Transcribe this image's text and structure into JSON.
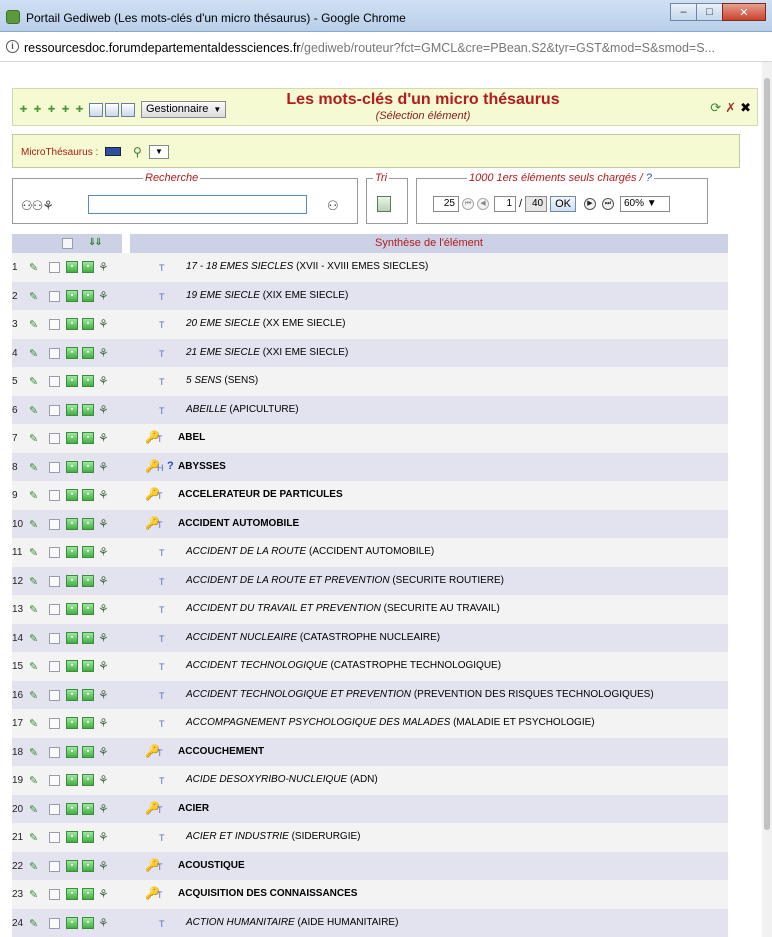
{
  "window": {
    "title": "Portail Gediweb (Les mots-clés d'un micro thésaurus) - Google Chrome",
    "controls": {
      "minimize": "–",
      "maximize": "□",
      "close": "✕"
    }
  },
  "address": {
    "host": "ressourcesdoc.forumdepartementaldessciences.fr",
    "path": "/gediweb/routeur?fct=GMCL&cre=PBean.S2&tyr=GST&mod=S&smod=S..."
  },
  "header": {
    "title": "Les mots-clés d'un micro thésaurus",
    "subtitle": "(Sélection élément)",
    "gestionnaire": "Gestionnaire"
  },
  "micro": {
    "label": "MicroThésaurus :"
  },
  "search": {
    "legend": "Recherche",
    "value": ""
  },
  "tri": {
    "legend": "Tri"
  },
  "pagination": {
    "legend": "1000 1ers éléments seuls chargés /",
    "help": "?",
    "per_page": "25",
    "current_page": "1",
    "separator": "/",
    "total_pages": "40",
    "ok": "OK",
    "zoom": "60%"
  },
  "grid": {
    "column_title": "Synthèse de l'élément",
    "rows": [
      {
        "n": "1",
        "type": "T",
        "key": false,
        "help": false,
        "term": "17 - 18 EMES SIECLES",
        "main": "(XVII - XVIII EMES SIECLES)"
      },
      {
        "n": "2",
        "type": "T",
        "key": false,
        "help": false,
        "term": "19 EME SIECLE",
        "main": "(XIX EME SIECLE)"
      },
      {
        "n": "3",
        "type": "T",
        "key": false,
        "help": false,
        "term": "20 EME SIECLE",
        "main": "(XX EME SIECLE)"
      },
      {
        "n": "4",
        "type": "T",
        "key": false,
        "help": false,
        "term": "21 EME SIECLE",
        "main": "(XXI EME SIECLE)"
      },
      {
        "n": "5",
        "type": "T",
        "key": false,
        "help": false,
        "term": "5 SENS",
        "main": "(SENS)"
      },
      {
        "n": "6",
        "type": "T",
        "key": false,
        "help": false,
        "term": "ABEILLE",
        "main": "(APICULTURE)"
      },
      {
        "n": "7",
        "type": "T",
        "key": true,
        "help": false,
        "term": "ABEL",
        "main": ""
      },
      {
        "n": "8",
        "type": "H",
        "key": true,
        "help": true,
        "term": "ABYSSES",
        "main": ""
      },
      {
        "n": "9",
        "type": "T",
        "key": true,
        "help": false,
        "term": "ACCELERATEUR DE PARTICULES",
        "main": ""
      },
      {
        "n": "10",
        "type": "T",
        "key": true,
        "help": false,
        "term": "ACCIDENT AUTOMOBILE",
        "main": ""
      },
      {
        "n": "11",
        "type": "T",
        "key": false,
        "help": false,
        "term": "ACCIDENT DE LA ROUTE",
        "main": "(ACCIDENT AUTOMOBILE)"
      },
      {
        "n": "12",
        "type": "T",
        "key": false,
        "help": false,
        "term": "ACCIDENT DE LA ROUTE ET PREVENTION",
        "main": "(SECURITE ROUTIERE)"
      },
      {
        "n": "13",
        "type": "T",
        "key": false,
        "help": false,
        "term": "ACCIDENT DU TRAVAIL ET PREVENTION",
        "main": "(SECURITE AU TRAVAIL)"
      },
      {
        "n": "14",
        "type": "T",
        "key": false,
        "help": false,
        "term": "ACCIDENT NUCLEAIRE",
        "main": "(CATASTROPHE NUCLEAIRE)"
      },
      {
        "n": "15",
        "type": "T",
        "key": false,
        "help": false,
        "term": "ACCIDENT TECHNOLOGIQUE",
        "main": "(CATASTROPHE TECHNOLOGIQUE)"
      },
      {
        "n": "16",
        "type": "T",
        "key": false,
        "help": false,
        "term": "ACCIDENT TECHNOLOGIQUE ET PREVENTION",
        "main": "(PREVENTION DES RISQUES TECHNOLOGIQUES)"
      },
      {
        "n": "17",
        "type": "T",
        "key": false,
        "help": false,
        "term": "ACCOMPAGNEMENT PSYCHOLOGIQUE DES MALADES",
        "main": "(MALADIE ET PSYCHOLOGIE)"
      },
      {
        "n": "18",
        "type": "T",
        "key": true,
        "help": false,
        "term": "ACCOUCHEMENT",
        "main": ""
      },
      {
        "n": "19",
        "type": "T",
        "key": false,
        "help": false,
        "term": "ACIDE DESOXYRIBO-NUCLEIQUE",
        "main": "(ADN)"
      },
      {
        "n": "20",
        "type": "T",
        "key": true,
        "help": false,
        "term": "ACIER",
        "main": ""
      },
      {
        "n": "21",
        "type": "T",
        "key": false,
        "help": false,
        "term": "ACIER ET INDUSTRIE",
        "main": "(SIDERURGIE)"
      },
      {
        "n": "22",
        "type": "T",
        "key": true,
        "help": false,
        "term": "ACOUSTIQUE",
        "main": ""
      },
      {
        "n": "23",
        "type": "T",
        "key": true,
        "help": false,
        "term": "ACQUISITION DES CONNAISSANCES",
        "main": ""
      },
      {
        "n": "24",
        "type": "T",
        "key": false,
        "help": false,
        "term": "ACTION HUMANITAIRE",
        "main": "(AIDE HUMANITAIRE)"
      }
    ]
  }
}
